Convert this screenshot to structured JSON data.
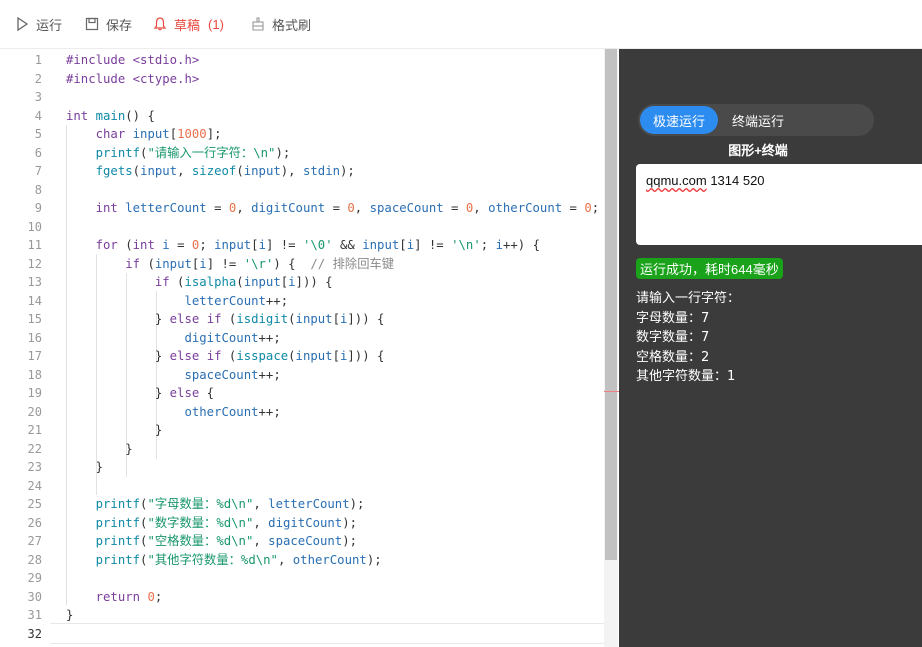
{
  "toolbar": {
    "run_label": "运行",
    "save_label": "保存",
    "draft_label": "草稿",
    "draft_count": "(1)",
    "format_label": "格式刷"
  },
  "editor": {
    "line_numbers": [
      "1",
      "2",
      "3",
      "4",
      "5",
      "6",
      "7",
      "8",
      "9",
      "10",
      "11",
      "12",
      "13",
      "14",
      "15",
      "16",
      "17",
      "18",
      "19",
      "20",
      "21",
      "22",
      "23",
      "24",
      "25",
      "26",
      "27",
      "28",
      "29",
      "30",
      "31",
      "32"
    ],
    "lines": [
      "#include <stdio.h>",
      "#include <ctype.h>",
      "",
      "int main() {",
      "    char input[1000];",
      "    printf(\"请输入一行字符：\\n\");",
      "    fgets(input, sizeof(input), stdin);",
      "",
      "    int letterCount = 0, digitCount = 0, spaceCount = 0, otherCount = 0;",
      "",
      "    for (int i = 0; input[i] != '\\0' && input[i] != '\\n'; i++) {",
      "        if (input[i] != '\\r') {  // 排除回车键",
      "            if (isalpha(input[i])) {",
      "                letterCount++;",
      "            } else if (isdigit(input[i])) {",
      "                digitCount++;",
      "            } else if (isspace(input[i])) {",
      "                spaceCount++;",
      "            } else {",
      "                otherCount++;",
      "            }",
      "        }",
      "    }",
      "",
      "    printf(\"字母数量：%d\\n\", letterCount);",
      "    printf(\"数字数量：%d\\n\", digitCount);",
      "    printf(\"空格数量：%d\\n\", spaceCount);",
      "    printf(\"其他字符数量：%d\\n\", otherCount);",
      "",
      "    return 0;",
      "}",
      ""
    ]
  },
  "output": {
    "mode_active": "极速运行",
    "mode_inactive": "终端运行",
    "mode_sub": "图形+终端",
    "input_word": "qqmu.com",
    "input_rest": " 1314 520",
    "status": "运行成功，耗时644毫秒",
    "result_lines": [
      "请输入一行字符：",
      "字母数量：7",
      "数字数量：7",
      "空格数量：2",
      "其他字符数量：1"
    ]
  },
  "colors": {
    "accent": "#2d8cf0",
    "success": "#1aa31a",
    "draft": "#e8483d",
    "panel": "#3b3b3b"
  }
}
